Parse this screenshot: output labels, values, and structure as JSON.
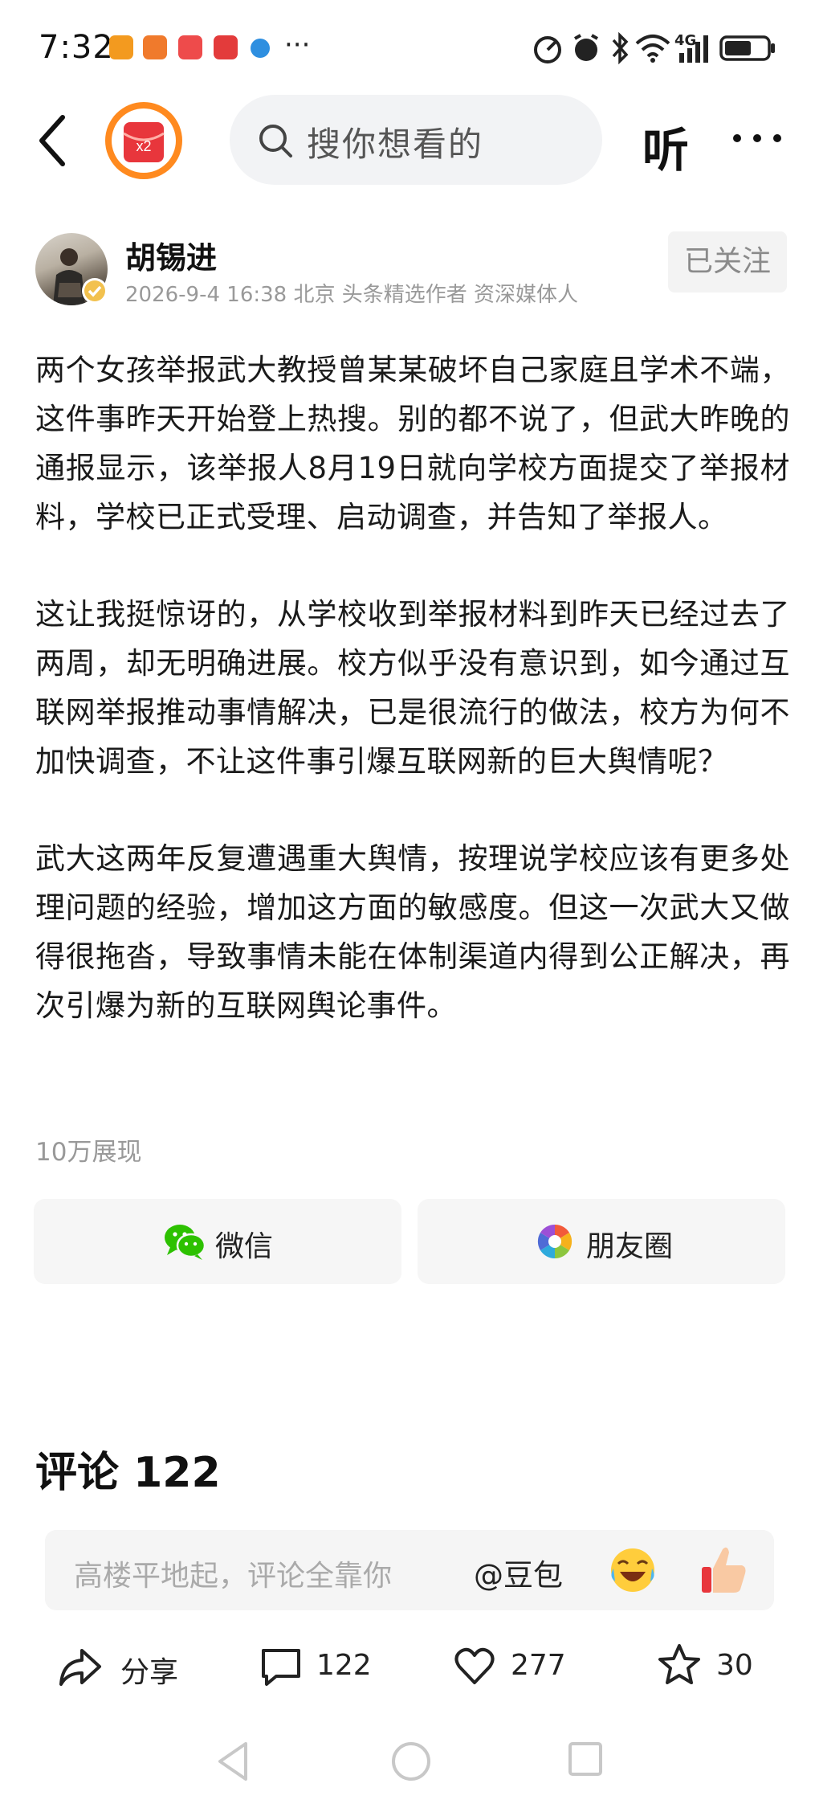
{
  "status_bar": {
    "time": "7:32",
    "more": "···",
    "network": "4G",
    "app_icon_colors": [
      "#f39a1f",
      "#f07a2c",
      "#ee4b4b",
      "#e33b3b",
      "#2e8fe0"
    ]
  },
  "header": {
    "search_placeholder": "搜你想看的",
    "listen_label": "听",
    "badge_text": "x2"
  },
  "author": {
    "name": "胡锡进",
    "meta": "2026-9-4 16:38 北京 头条精选作者 资深媒体人",
    "follow_label": "已关注"
  },
  "article": {
    "paragraphs": [
      "两个女孩举报武大教授曾某某破坏自己家庭且学术不端，这件事昨天开始登上热搜。别的都不说了，但武大昨晚的通报显示，该举报人8月19日就向学校方面提交了举报材料，学校已正式受理、启动调查，并告知了举报人。",
      "这让我挺惊讶的，从学校收到举报材料到昨天已经过去了两周，却无明确进展。校方似乎没有意识到，如今通过互联网举报推动事情解决，已是很流行的做法，校方为何不加快调查，不让这件事引爆互联网新的巨大舆情呢？",
      "武大这两年反复遭遇重大舆情，按理说学校应该有更多处理问题的经验，增加这方面的敏感度。但这一次武大又做得很拖沓，导致事情未能在体制渠道内得到公正解决，再次引爆为新的互联网舆论事件。"
    ],
    "views": "10万展现"
  },
  "share": {
    "wechat_label": "微信",
    "moments_label": "朋友圈"
  },
  "comments": {
    "title": "评论 122",
    "placeholder": "高楼平地起，评论全靠你",
    "mention": "@豆包"
  },
  "bottom_bar": {
    "share_label": "分享",
    "comment_count": "122",
    "like_count": "277",
    "favorite_count": "30"
  },
  "colors": {
    "accent_red": "#e8363c",
    "wechat_green": "#2dc100",
    "text_secondary": "#999999"
  }
}
